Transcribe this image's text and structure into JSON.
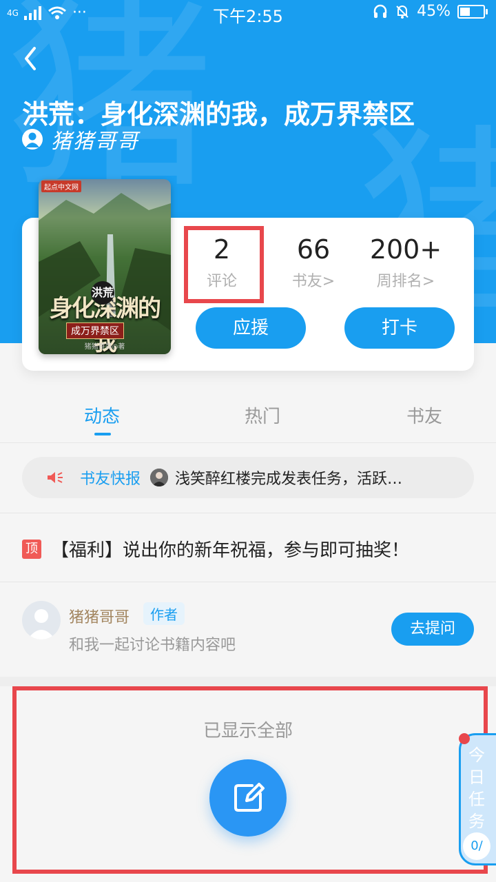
{
  "statusbar": {
    "network": "4G",
    "dots": "···",
    "time": "下午2:55",
    "battery": "45%",
    "battery_level": 0.45
  },
  "header": {
    "watermark_char": "猪",
    "title": "洪荒：身化深渊的我，成万界禁区",
    "author": "猪猪哥哥"
  },
  "cover": {
    "publisher": "起点中文网",
    "title_overlay": "身化深渊的我",
    "tag": "洪荒",
    "subtitle": "成万界禁区",
    "credit": "猪猪哥哥◎著"
  },
  "stats": {
    "comments": {
      "value": "2",
      "label": "评论"
    },
    "friends": {
      "value": "66",
      "label": "书友>"
    },
    "rank": {
      "value": "200+",
      "label": "周排名>"
    }
  },
  "actions": {
    "support": "应援",
    "checkin": "打卡"
  },
  "tabs": [
    "动态",
    "热门",
    "书友"
  ],
  "news": {
    "label": "书友快报",
    "text": "浅笑醉红楼完成发表任务，活跃…"
  },
  "pinned": {
    "badge": "顶",
    "text": "【福利】说出你的新年祝福，参与即可抽奖！"
  },
  "author_card": {
    "name": "猪猪哥哥",
    "tag": "作者",
    "desc": "和我一起讨论书籍内容吧",
    "button": "去提问"
  },
  "footer": {
    "end_text": "已显示全部"
  },
  "daily_task": {
    "label": "今日任务",
    "count": "0/"
  },
  "colors": {
    "primary": "#199ef0",
    "highlight": "#e8474c"
  }
}
